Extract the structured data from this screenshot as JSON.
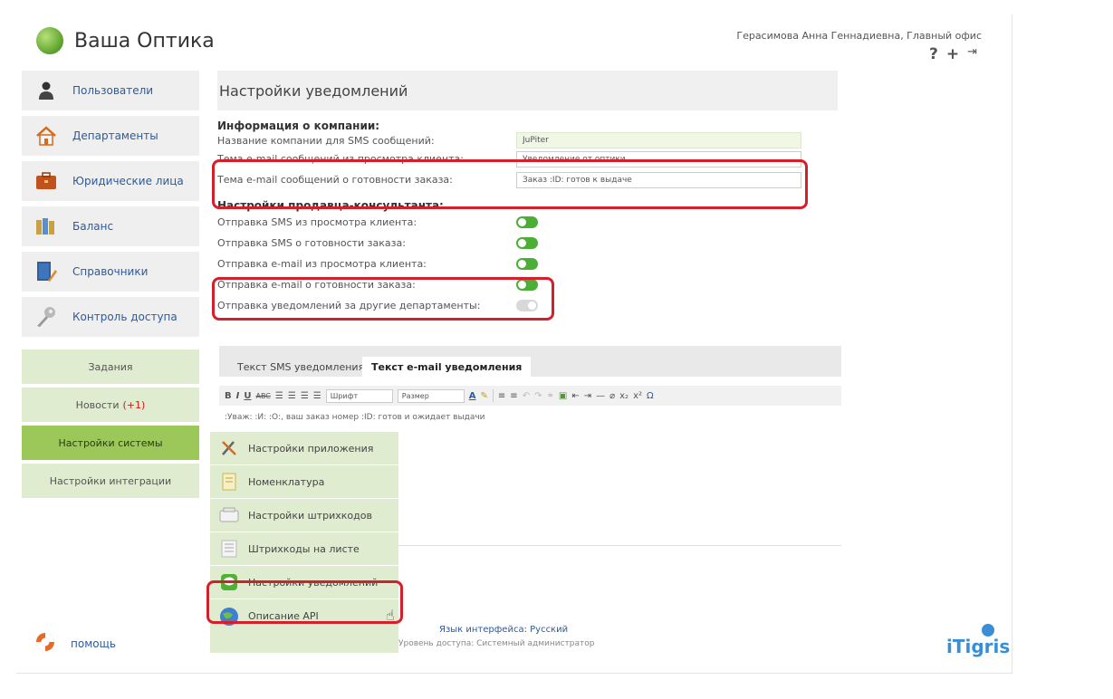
{
  "app": {
    "logo_text": "Ваша Оптика",
    "brand": "iTigris"
  },
  "header": {
    "user": "Герасимова Анна Геннадиевна, Главный офис",
    "icons": [
      "help-icon",
      "add-icon",
      "logout-icon"
    ]
  },
  "sidebar": {
    "items": [
      {
        "label": "Пользователи",
        "icon": "user-icon"
      },
      {
        "label": "Департаменты",
        "icon": "home-icon"
      },
      {
        "label": "Юридические лица",
        "icon": "briefcase-icon"
      },
      {
        "label": "Баланс",
        "icon": "books-icon"
      },
      {
        "label": "Справочники",
        "icon": "book-pen-icon"
      },
      {
        "label": "Контроль доступа",
        "icon": "key-icon"
      }
    ],
    "green_items": [
      {
        "label": "Задания",
        "badge": ""
      },
      {
        "label": "Новости",
        "badge": "(+1)"
      },
      {
        "label": "Настройки системы",
        "badge": ""
      },
      {
        "label": "Настройки интеграции",
        "badge": ""
      }
    ]
  },
  "main": {
    "title": "Настройки уведомлений",
    "company_section": "Информация о компании:",
    "company_name_label": "Название компании для SMS сообщений:",
    "company_name_value": "JuPiter",
    "email_subject_view_label": "Тема e-mail сообщений из просмотра клиента:",
    "email_subject_view_value": "Уведомление от оптики",
    "email_subject_ready_label": "Тема e-mail сообщений о готовности заказа:",
    "email_subject_ready_value": "Заказ :ID: готов к выдаче",
    "seller_section": "Настройки продавца-консультанта:",
    "toggles": [
      {
        "label": "Отправка SMS из просмотра клиента:",
        "on": true
      },
      {
        "label": "Отправка SMS о готовности заказа:",
        "on": true
      },
      {
        "label": "Отправка e-mail из просмотра клиента:",
        "on": true
      },
      {
        "label": "Отправка e-mail о готовности заказа:",
        "on": true
      },
      {
        "label": "Отправка уведомлений за другие департаменты:",
        "on": false
      }
    ]
  },
  "editor": {
    "tab_sms": "Текст SMS уведомления",
    "tab_email": "Текст e-mail уведомления",
    "font_select": "Шрифт",
    "size_select": "Размер",
    "text": ":Уваж: :И: :О:, ваш заказ номер :ID: готов и ожидает выдачи"
  },
  "dropdown": {
    "items": [
      {
        "label": "Настройки приложения",
        "icon": "tools-icon"
      },
      {
        "label": "Номенклатура",
        "icon": "document-icon"
      },
      {
        "label": "Настройки штрихкодов",
        "icon": "keyboard-icon"
      },
      {
        "label": "Штрихкоды на листе",
        "icon": "barcode-sheet-icon"
      },
      {
        "label": "Настройки уведомлений",
        "icon": "chat-icon"
      },
      {
        "label": "Описание API",
        "icon": "globe-icon"
      }
    ]
  },
  "footer": {
    "help": "помощь",
    "language": "Язык интерфейса: Русский",
    "access": "Уровень доступа: Системный администратор"
  },
  "colors": {
    "accent": "#9cc85a",
    "highlight": "#d4202a",
    "link": "#2e5a9a",
    "toggle_on": "#4caf35"
  }
}
